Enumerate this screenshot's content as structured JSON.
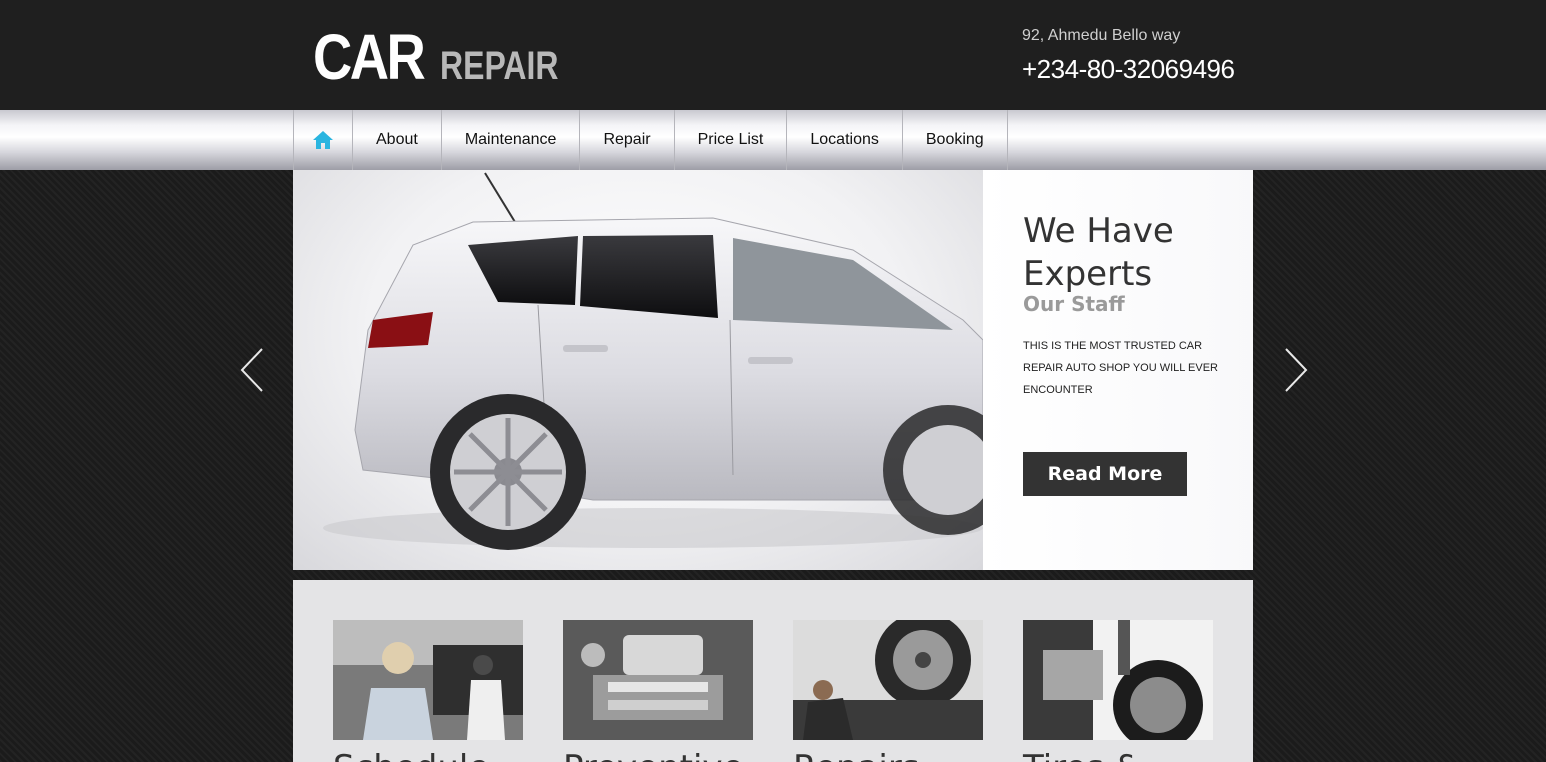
{
  "header": {
    "logo_main": "CAR",
    "logo_sub": "REPAIR",
    "address": "92, Ahmedu Bello way",
    "phone": "+234-80-32069496"
  },
  "nav": {
    "items": [
      "About",
      "Maintenance",
      "Repair",
      "Price List",
      "Locations",
      "Booking"
    ],
    "home_icon_color": "#2ab5e0"
  },
  "slider": {
    "title": "We Have Experts",
    "subtitle": "Our Staff",
    "description": "THIS IS THE MOST TRUSTED CAR REPAIR AUTO SHOP YOU WILL EVER ENCOUNTER",
    "button": "Read More"
  },
  "features": {
    "titles": [
      "Schedule",
      "Preventive",
      "Repairs",
      "Tires &"
    ]
  },
  "colors": {
    "header_bg": "#1f1f1f",
    "button_bg": "#333333",
    "features_bg": "#e4e4e6"
  }
}
